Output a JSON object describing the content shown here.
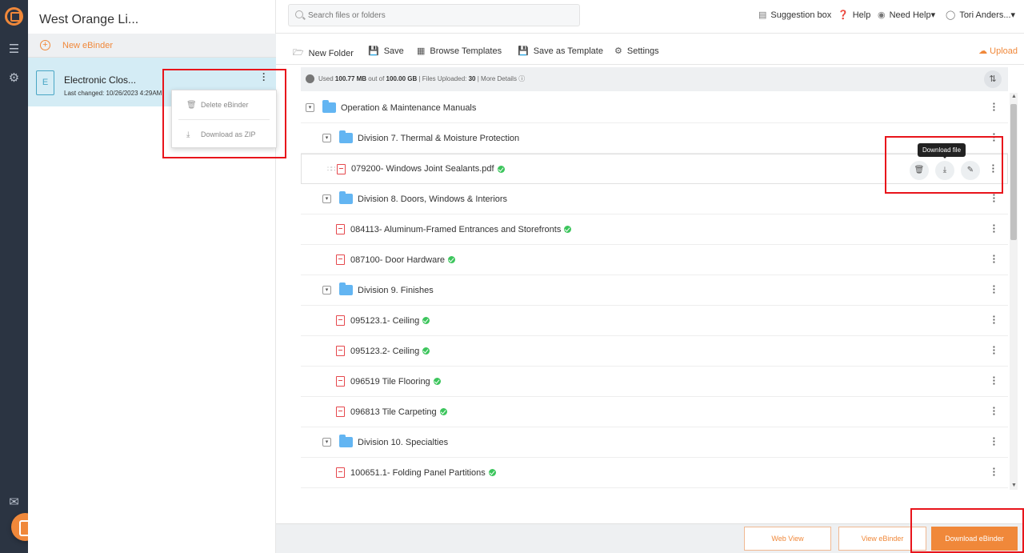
{
  "project_title": "West Orange Li...",
  "sidebar": {
    "new_ebinder": "New eBinder",
    "ebinder": {
      "name": "Electronic Clos...",
      "last_changed": "Last changed: 10/26/2023 4:29AM",
      "menu": [
        "Delete eBinder",
        "Download as ZIP"
      ]
    }
  },
  "search": {
    "placeholder": "Search files or folders"
  },
  "topnav": {
    "suggestion": "Suggestion box",
    "help": "Help",
    "need_help": "Need Help▾",
    "user": "Tori Anders...▾"
  },
  "toolbar": {
    "new_folder": "New Folder",
    "save": "Save",
    "browse_templates": "Browse Templates",
    "save_as_template": "Save as Template",
    "settings": "Settings",
    "upload": "Upload"
  },
  "storage": {
    "used_label": "Used",
    "used": "100.77 MB",
    "out_of": "out of",
    "total": "100.00 GB",
    "files_uploaded_label": "| Files Uploaded:",
    "files_uploaded": "30",
    "more_details": "| More Details"
  },
  "tree": [
    {
      "type": "folder",
      "level": 0,
      "name": "Operation & Maintenance Manuals"
    },
    {
      "type": "folder",
      "level": 1,
      "name": "Division 7. Thermal & Moisture Protection"
    },
    {
      "type": "file",
      "level": 2,
      "name": "079200- Windows Joint Sealants.pdf",
      "selected": true
    },
    {
      "type": "folder",
      "level": 1,
      "name": "Division 8. Doors, Windows & Interiors"
    },
    {
      "type": "file",
      "level": 2,
      "name": "084113- Aluminum-Framed Entrances and Storefronts"
    },
    {
      "type": "file",
      "level": 2,
      "name": "087100- Door Hardware"
    },
    {
      "type": "folder",
      "level": 1,
      "name": "Division 9. Finishes"
    },
    {
      "type": "file",
      "level": 2,
      "name": "095123.1- Ceiling"
    },
    {
      "type": "file",
      "level": 2,
      "name": "095123.2- Ceiling"
    },
    {
      "type": "file",
      "level": 2,
      "name": "096519 Tile Flooring"
    },
    {
      "type": "file",
      "level": 2,
      "name": "096813 Tile Carpeting"
    },
    {
      "type": "folder",
      "level": 1,
      "name": "Division 10. Specialties"
    },
    {
      "type": "file",
      "level": 2,
      "name": "100651.1- Folding Panel Partitions"
    }
  ],
  "tooltip": "Download file",
  "footer": {
    "web_view": "Web View",
    "view_ebinder": "View eBinder",
    "download_ebinder": "Download eBinder"
  },
  "colors": {
    "accent": "#f0883a",
    "rail": "#2b3442",
    "folder": "#63b5f2",
    "pdf": "#e5484d",
    "check": "#3cc55c",
    "highlight": "#e8141b"
  }
}
